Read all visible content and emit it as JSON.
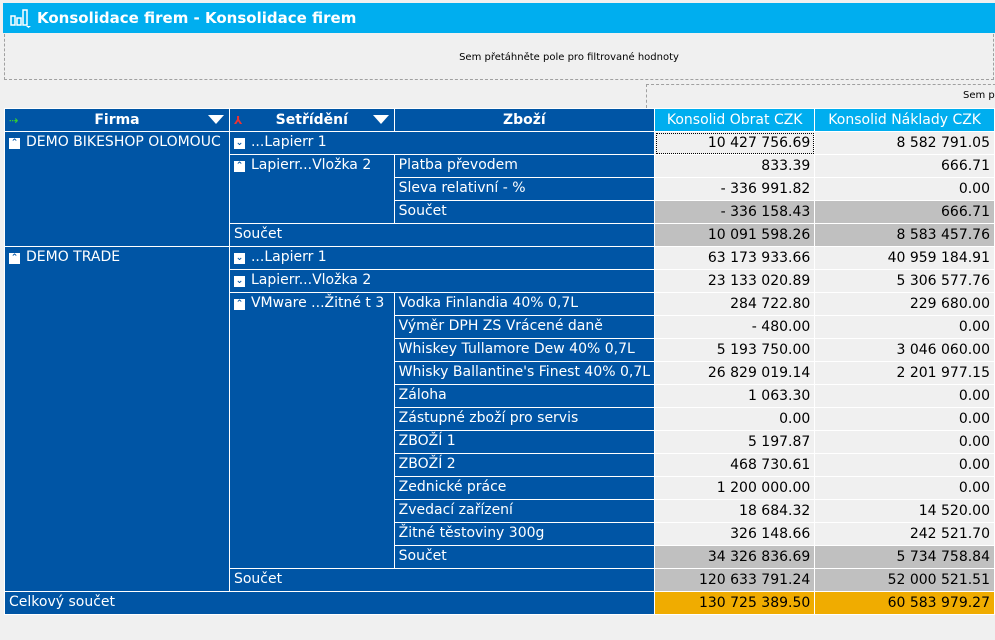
{
  "window": {
    "title": "Konsolidace firem - Konsolidace firem",
    "icon": "bar-chart-icon"
  },
  "filter_zone": {
    "hint": "Sem přetáhněte pole pro filtrované hodnoty"
  },
  "column_zone": {
    "hint": "Sem přetáhněte pole sloupců"
  },
  "colors": {
    "title": "#00aeef",
    "row_header": "#0055a5",
    "subtotal": "#c0c0c0",
    "grand_total": "#f0ac00"
  },
  "headers": {
    "firma": "Firma",
    "setrideni": "Setřídění",
    "zbozi": "Zboží",
    "obrat": "Konsolid Obrat CZK",
    "naklady": "Konsolid Náklady CZK"
  },
  "groups": [
    {
      "firma": "DEMO BIKESHOP OLOMOUC",
      "subgroups": [
        {
          "label": "...Lapierr 1",
          "expanded": false,
          "obrat": "10 427 756.69",
          "naklady": "8 582 791.05"
        },
        {
          "label": "Lapierr...Vložka  2",
          "expanded": true,
          "items": [
            {
              "name": "Platba převodem",
              "obrat": "833.39",
              "naklady": "666.71"
            },
            {
              "name": "Sleva relativní - %",
              "obrat": "- 336 991.82",
              "naklady": "0.00"
            }
          ],
          "subtotal": {
            "label": "Součet",
            "obrat": "- 336 158.43",
            "naklady": "666.71"
          }
        }
      ],
      "total": {
        "label": "Součet",
        "obrat": "10 091 598.26",
        "naklady": "8 583 457.76"
      }
    },
    {
      "firma": "DEMO TRADE",
      "subgroups": [
        {
          "label": "...Lapierr 1",
          "expanded": false,
          "obrat": "63 173 933.66",
          "naklady": "40 959 184.91"
        },
        {
          "label": "Lapierr...Vložka  2",
          "expanded": false,
          "obrat": "23 133 020.89",
          "naklady": "5 306 577.76"
        },
        {
          "label": "VMware ...Žitné t 3",
          "expanded": true,
          "items": [
            {
              "name": "Vodka Finlandia 40% 0,7L",
              "obrat": "284 722.80",
              "naklady": "229 680.00"
            },
            {
              "name": "Výměr DPH  ZS Vrácené daně",
              "obrat": "-  480.00",
              "naklady": "0.00"
            },
            {
              "name": "Whiskey Tullamore Dew 40% 0,7L",
              "obrat": "5 193 750.00",
              "naklady": "3 046 060.00"
            },
            {
              "name": "Whisky Ballantine's Finest 40% 0,7L",
              "obrat": "26 829 019.14",
              "naklady": "2 201 977.15"
            },
            {
              "name": "Záloha",
              "obrat": "1 063.30",
              "naklady": "0.00"
            },
            {
              "name": "Zástupné zboží pro servis",
              "obrat": "0.00",
              "naklady": "0.00"
            },
            {
              "name": "ZBOŽÍ 1",
              "obrat": "5 197.87",
              "naklady": "0.00"
            },
            {
              "name": "ZBOŽÍ 2",
              "obrat": "468 730.61",
              "naklady": "0.00"
            },
            {
              "name": "Zednické práce",
              "obrat": "1 200 000.00",
              "naklady": "0.00"
            },
            {
              "name": "Zvedací zařízení",
              "obrat": "18 684.32",
              "naklady": "14 520.00"
            },
            {
              "name": "Žitné těstoviny 300g",
              "obrat": "326 148.66",
              "naklady": "242 521.70"
            }
          ],
          "subtotal": {
            "label": "Součet",
            "obrat": "34 326 836.69",
            "naklady": "5 734 758.84"
          }
        }
      ],
      "total": {
        "label": "Součet",
        "obrat": "120 633 791.24",
        "naklady": "52 000 521.51"
      }
    }
  ],
  "grand_total": {
    "label": "Celkový součet",
    "obrat": "130 725 389.50",
    "naklady": "60 583 979.27"
  }
}
